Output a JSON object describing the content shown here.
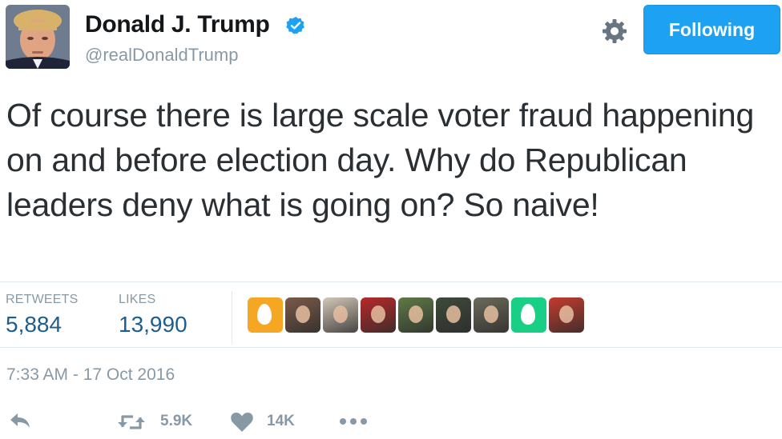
{
  "author": {
    "name": "Donald J. Trump",
    "handle": "@realDonaldTrump",
    "verified": true
  },
  "header": {
    "follow_label": "Following",
    "gear_icon": "gear-icon"
  },
  "tweet": {
    "text": "Of course there is large scale voter fraud happening on and before election day. Why do Republican leaders deny what is going on? So naive!"
  },
  "stats": {
    "retweets_label": "RETWEETS",
    "retweets_value": "5,884",
    "likes_label": "LIKES",
    "likes_value": "13,990"
  },
  "likers": [
    {
      "kind": "egg",
      "color": "#f5a623"
    },
    {
      "kind": "photo",
      "color": "#7a5a48"
    },
    {
      "kind": "photo",
      "color": "#d3c7b8"
    },
    {
      "kind": "photo",
      "color": "#b72a2a"
    },
    {
      "kind": "photo",
      "color": "#5f7a46"
    },
    {
      "kind": "photo",
      "color": "#3d4a3a"
    },
    {
      "kind": "photo",
      "color": "#6b6a5a"
    },
    {
      "kind": "egg",
      "color": "#19cf86"
    },
    {
      "kind": "photo",
      "color": "#c43b2e"
    }
  ],
  "timestamp": "7:33 AM - 17 Oct 2016",
  "actions": {
    "reply_icon": "reply-icon",
    "retweet_icon": "retweet-icon",
    "retweet_count": "5.9K",
    "like_icon": "heart-icon",
    "like_count": "14K",
    "more_icon": "more-icon"
  },
  "colors": {
    "accent": "#1da1f2",
    "stat_value": "#1b5e8f",
    "muted": "#8899a6",
    "text": "#292f33"
  }
}
